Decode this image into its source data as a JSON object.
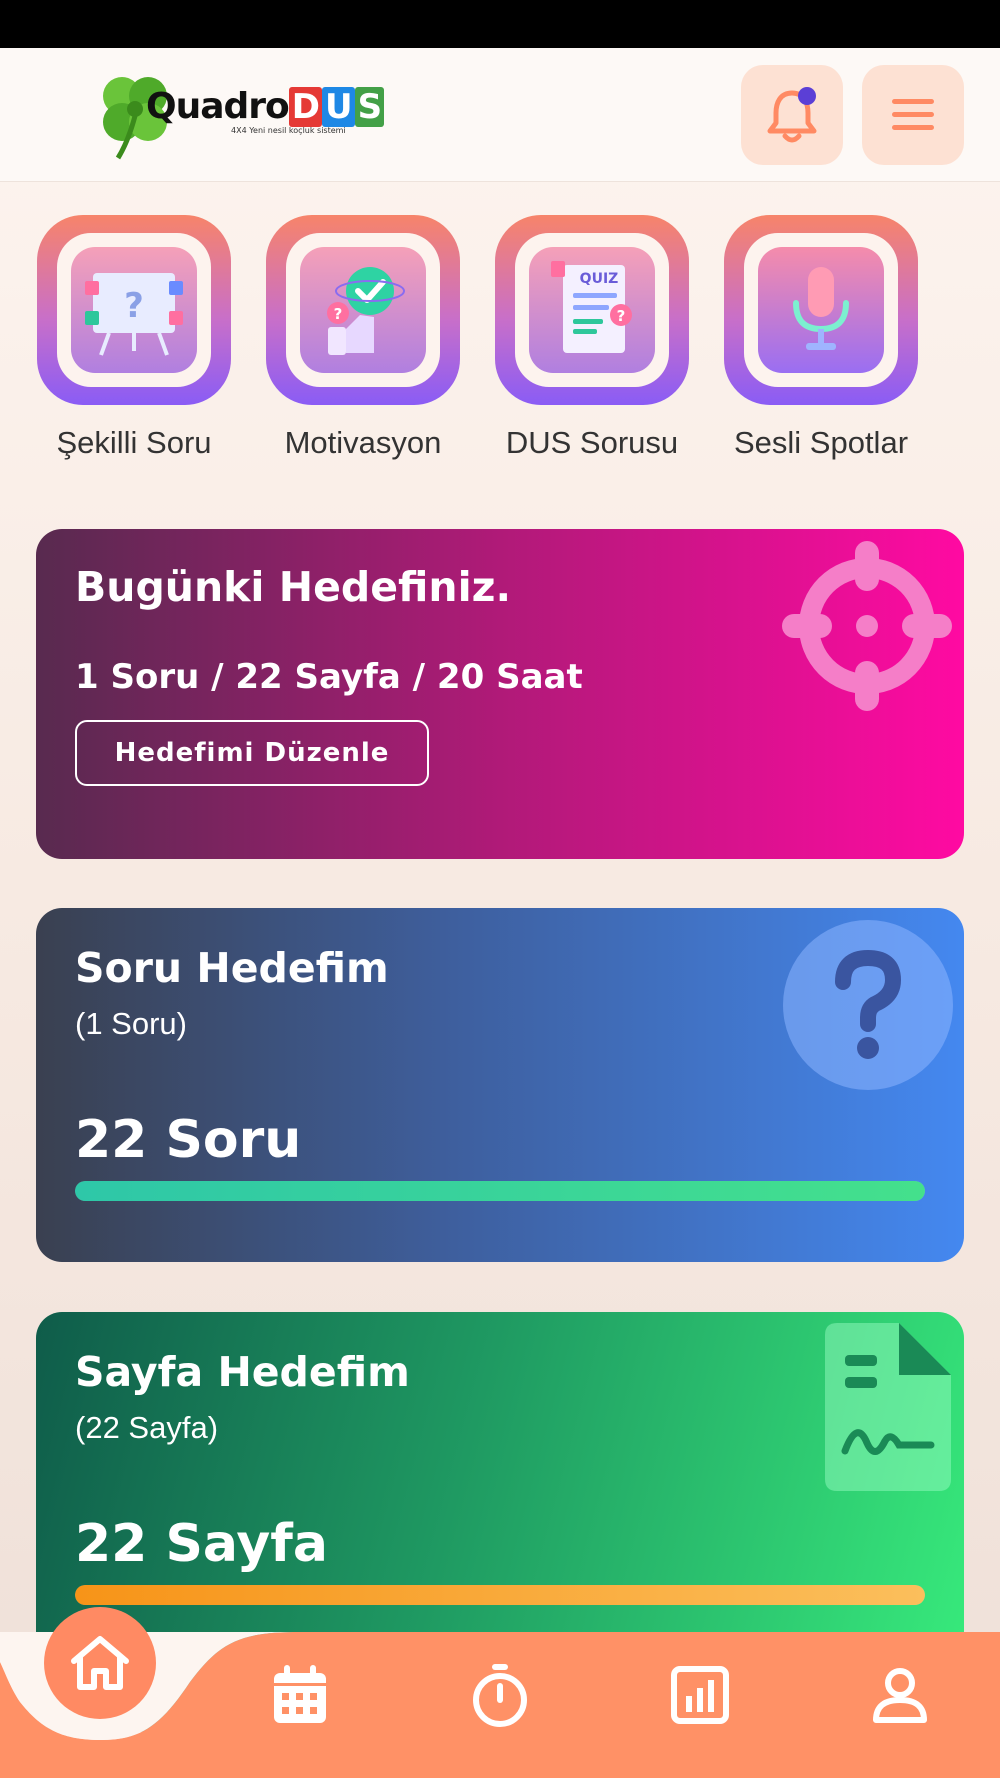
{
  "app": {
    "name": "QuadroDUS",
    "logo_main": "Quadro",
    "logo_letters": [
      "D",
      "U",
      "S"
    ],
    "logo_tagline": "4X4 Yeni nesil koçluk sistemi"
  },
  "header": {
    "notification_icon": "bell-icon",
    "menu_icon": "hamburger-menu-icon",
    "accent_color": "#ff8a63"
  },
  "categories": [
    {
      "label": "Şekilli Soru",
      "icon": "presentation-board-icon"
    },
    {
      "label": "Motivasyon",
      "icon": "thumbs-up-check-icon"
    },
    {
      "label": "DUS Sorusu",
      "icon": "quiz-icon"
    },
    {
      "label": "Sesli Spotlar",
      "icon": "microphone-icon"
    }
  ],
  "today_goal": {
    "title": "Bugünki Hedefiniz.",
    "summary": "1 Soru / 22 Sayfa / 20 Saat",
    "edit_button": "Hedefimi Düzenle",
    "icon": "crosshair-target-icon"
  },
  "question_goal": {
    "title": "Soru Hedefim",
    "subtitle": "(1 Soru)",
    "value": "22 Soru",
    "progress": 1.0,
    "icon": "question-mark-icon",
    "bar_color": "#2ec7a8"
  },
  "page_goal": {
    "title": "Sayfa Hedefim",
    "subtitle": "(22 Sayfa)",
    "value": "22 Sayfa",
    "progress": 1.0,
    "icon": "signed-document-icon",
    "bar_color": "#f7a21b"
  },
  "tabbar": {
    "tabs": [
      {
        "name": "home",
        "icon": "home-icon",
        "active": true
      },
      {
        "name": "calendar",
        "icon": "calendar-icon"
      },
      {
        "name": "timer",
        "icon": "stopwatch-icon"
      },
      {
        "name": "stats",
        "icon": "bar-chart-icon"
      },
      {
        "name": "profile",
        "icon": "user-icon"
      }
    ],
    "background": "#ff9166"
  }
}
